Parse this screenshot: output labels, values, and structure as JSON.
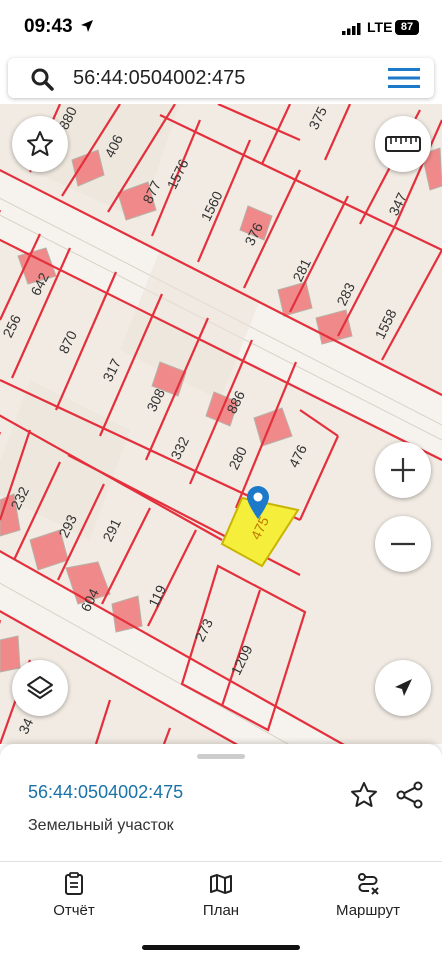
{
  "status_bar": {
    "time": "09:43",
    "network": "LTE",
    "battery": "87"
  },
  "search": {
    "query": "56:44:0504002:475"
  },
  "map": {
    "parcel_labels": [
      "880",
      "406",
      "877",
      "1576",
      "1560",
      "376",
      "281",
      "283",
      "1558",
      "375",
      "347",
      "642",
      "256",
      "870",
      "317",
      "308",
      "886",
      "332",
      "280",
      "476",
      "475",
      "232",
      "293",
      "291",
      "604",
      "119",
      "273",
      "1209",
      "34"
    ],
    "selected_parcel": "475",
    "colors": {
      "parcel_border": "#e4303c",
      "building": "#f08a8a",
      "selected_fill": "#f5ef3c",
      "pin": "#1d79c9"
    }
  },
  "controls": {
    "zoom_in": "+",
    "zoom_out": "−"
  },
  "sheet": {
    "cadastral_number": "56:44:0504002:475",
    "parcel_type": "Земельный участок"
  },
  "tabs": [
    {
      "label": "Отчёт",
      "icon": "report-icon"
    },
    {
      "label": "План",
      "icon": "map-icon"
    },
    {
      "label": "Маршрут",
      "icon": "route-icon"
    }
  ]
}
